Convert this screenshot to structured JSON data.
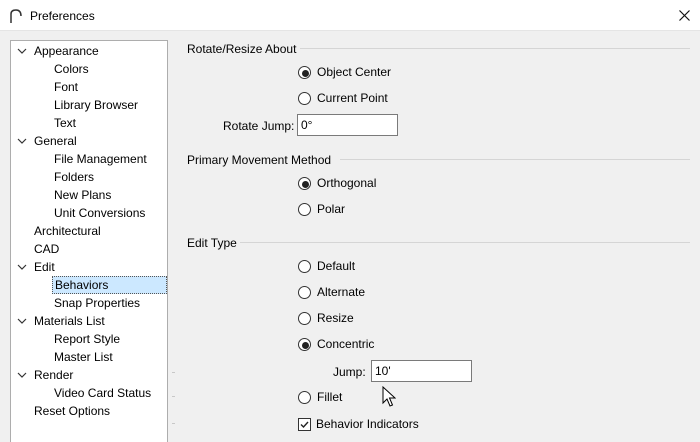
{
  "window": {
    "title": "Preferences"
  },
  "tree": {
    "items": [
      {
        "label": "Appearance",
        "level": 0,
        "expanded": true
      },
      {
        "label": "Colors",
        "level": 1
      },
      {
        "label": "Font",
        "level": 1
      },
      {
        "label": "Library Browser",
        "level": 1
      },
      {
        "label": "Text",
        "level": 1
      },
      {
        "label": "General",
        "level": 0,
        "expanded": true
      },
      {
        "label": "File Management",
        "level": 1
      },
      {
        "label": "Folders",
        "level": 1
      },
      {
        "label": "New Plans",
        "level": 1
      },
      {
        "label": "Unit Conversions",
        "level": 1
      },
      {
        "label": "Architectural",
        "level": 0
      },
      {
        "label": "CAD",
        "level": 0
      },
      {
        "label": "Edit",
        "level": 0,
        "expanded": true
      },
      {
        "label": "Behaviors",
        "level": 1,
        "selected": true
      },
      {
        "label": "Snap Properties",
        "level": 1
      },
      {
        "label": "Materials List",
        "level": 0,
        "expanded": true
      },
      {
        "label": "Report Style",
        "level": 1
      },
      {
        "label": "Master List",
        "level": 1
      },
      {
        "label": "Render",
        "level": 0,
        "expanded": true
      },
      {
        "label": "Video Card Status",
        "level": 1
      },
      {
        "label": "Reset Options",
        "level": 0
      }
    ]
  },
  "rotate_resize": {
    "title": "Rotate/Resize About",
    "options": [
      {
        "label": "Object Center",
        "checked": true
      },
      {
        "label": "Current Point",
        "checked": false
      }
    ],
    "rotate_jump_label": "Rotate Jump:",
    "rotate_jump_value": "0°"
  },
  "movement": {
    "title": "Primary Movement Method",
    "options": [
      {
        "label": "Orthogonal",
        "checked": true
      },
      {
        "label": "Polar",
        "checked": false
      }
    ]
  },
  "edit_type": {
    "title": "Edit Type",
    "options": [
      {
        "label": "Default",
        "checked": false
      },
      {
        "label": "Alternate",
        "checked": false
      },
      {
        "label": "Resize",
        "checked": false
      },
      {
        "label": "Concentric",
        "checked": true
      },
      {
        "label": "Fillet",
        "checked": false
      }
    ],
    "jump_label": "Jump:",
    "jump_value": "10'",
    "behavior_indicators_label": "Behavior Indicators",
    "behavior_indicators_checked": true
  }
}
